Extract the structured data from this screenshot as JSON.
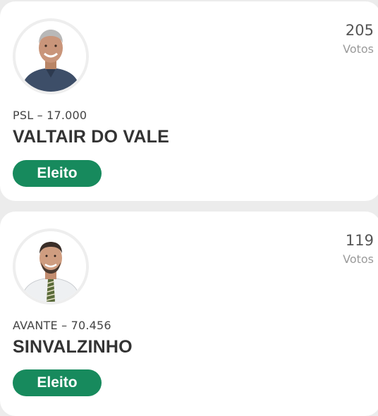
{
  "candidates": [
    {
      "votes": "205",
      "votes_label": "Votos",
      "party_number": "PSL – 17.000",
      "name": "VALTAIR DO VALE",
      "status": "Eleito",
      "photo_icon": "candidate-photo"
    },
    {
      "votes": "119",
      "votes_label": "Votos",
      "party_number": "AVANTE – 70.456",
      "name": "SINVALZINHO",
      "status": "Eleito",
      "photo_icon": "candidate-photo"
    }
  ],
  "colors": {
    "status_badge": "#178a5d",
    "background": "#ececec",
    "card": "#ffffff"
  }
}
